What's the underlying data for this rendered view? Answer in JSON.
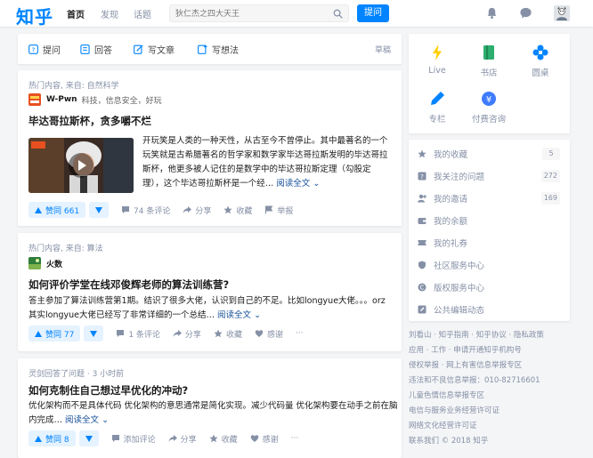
{
  "header": {
    "logo": "知乎",
    "nav": [
      "首页",
      "发现",
      "话题"
    ],
    "search_placeholder": "狄仁杰之四大天王",
    "ask_label": "提问"
  },
  "composer": {
    "items": [
      "提问",
      "回答",
      "写文章",
      "写想法"
    ],
    "draft": "草稿"
  },
  "feed": [
    {
      "meta": "热门内容, 来自: 自然科学",
      "author_name": "W-Pwn",
      "author_desc": "科技，信息安全，好玩",
      "title": "毕达哥拉斯杯，贪多嚼不烂",
      "excerpt_lines": [
        "开玩笑是人类的一种天性，从古至今不曾停止。其中最著名的一个",
        "玩笑就是古希腊著名的哲学家和数学家毕达哥拉斯发明的毕达哥拉",
        "斯杯，他更多被人记住的是数学中的毕达哥拉斯定理（勾股定",
        "理），这个毕达哥拉斯杯是一个经…"
      ],
      "readmore": "阅读全文",
      "vote": "赞同 661",
      "actions": [
        "74 条评论",
        "分享",
        "收藏",
        "举报"
      ]
    },
    {
      "meta": "热门内容, 来自: 算法",
      "author_name": "火数",
      "title": "如何评价学堂在线邓俊辉老师的算法训练营?",
      "excerpt_lines": [
        "答主参加了算法训练营第1期。结识了很多大佬，认识到自己的不足。比如longyue大佬。。。orz",
        "其实longyue大佬已经写了非常详细的一个总结…"
      ],
      "readmore": "阅读全文",
      "vote": "赞同 77",
      "actions": [
        "1 条评论",
        "分享",
        "收藏",
        "感谢",
        "···"
      ]
    },
    {
      "meta": "灵剑回答了问题 · 3 小时前",
      "title": "如何克制住自己想过早优化的冲动?",
      "excerpt_lines": [
        "优化架构而不是具体代码 优化架构的意思通常是简化实现。减少代码量 优化架构要在动手之前在脑",
        "内完成…"
      ],
      "readmore": "阅读全文",
      "vote": "赞同 8",
      "actions": [
        "添加评论",
        "分享",
        "收藏",
        "感谢",
        "···"
      ]
    }
  ],
  "sidebar": {
    "grid": [
      "Live",
      "书店",
      "圆桌",
      "专栏",
      "付费咨询"
    ],
    "list": [
      {
        "label": "我的收藏",
        "count": "5"
      },
      {
        "label": "我关注的问题",
        "count": "272"
      },
      {
        "label": "我的邀请",
        "count": "169"
      },
      {
        "label": "我的余额"
      },
      {
        "label": "我的礼券"
      },
      {
        "label": "社区服务中心"
      },
      {
        "label": "版权服务中心"
      },
      {
        "label": "公共编辑动态"
      }
    ],
    "footer": [
      "刘看山 · 知乎指南 · 知乎协议 · 隐私政策",
      "应用 · 工作 · 申请开通知乎机构号",
      "侵权举报 · 网上有害信息举报专区",
      "违法和不良信息举报：010-82716601",
      "儿童色情信息举报专区",
      "电信与服务业务经营许可证",
      "网络文化经营许可证",
      "联系我们 © 2018 知乎"
    ]
  },
  "colors": {
    "brand": "#0084ff",
    "text_secondary": "#8590a6",
    "link": "#175199"
  }
}
